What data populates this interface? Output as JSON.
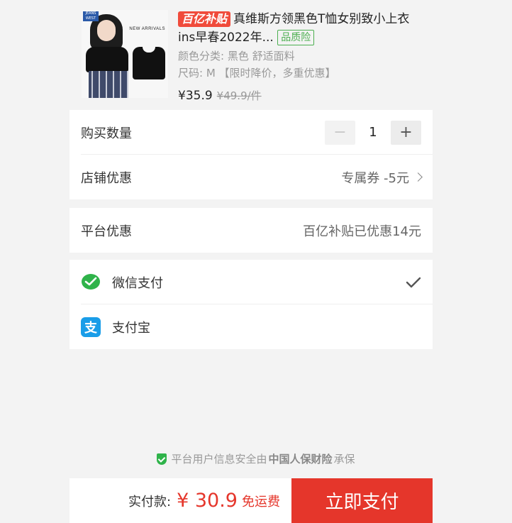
{
  "product": {
    "badge": "百亿补贴",
    "title": "真维斯方领黑色T恤女别致小上衣ins早春2022年...",
    "quality_tag": "品质险",
    "color_line": "颜色分类: 黑色 舒适面料",
    "size_line": "尺码: M 【限时降价，多重优惠】",
    "price": "¥35.9",
    "original_price": "¥49.9/件",
    "image_text": "NEW ARRIVALS",
    "logo_text": "JEANS WEST"
  },
  "quantity": {
    "label": "购买数量",
    "value": "1",
    "minus": "−",
    "plus": "+"
  },
  "shop_discount": {
    "label": "店铺优惠",
    "value": "专属券 -5元"
  },
  "platform_discount": {
    "label": "平台优惠",
    "value": "百亿补贴已优惠14元"
  },
  "payment": {
    "wechat_label": "微信支付",
    "alipay_label": "支付宝",
    "alipay_glyph": "支",
    "selected": "wechat"
  },
  "security": {
    "prefix": "平台用户信息安全由",
    "insurer": "中国人保财险",
    "suffix": "承保"
  },
  "footer": {
    "total_label": "实付款:",
    "total_amount": "¥ 30.9",
    "shipping": "免运费",
    "pay_button": "立即支付"
  },
  "colors": {
    "accent": "#e5362b",
    "wechat": "#2fb34a",
    "alipay": "#1a9de8"
  }
}
